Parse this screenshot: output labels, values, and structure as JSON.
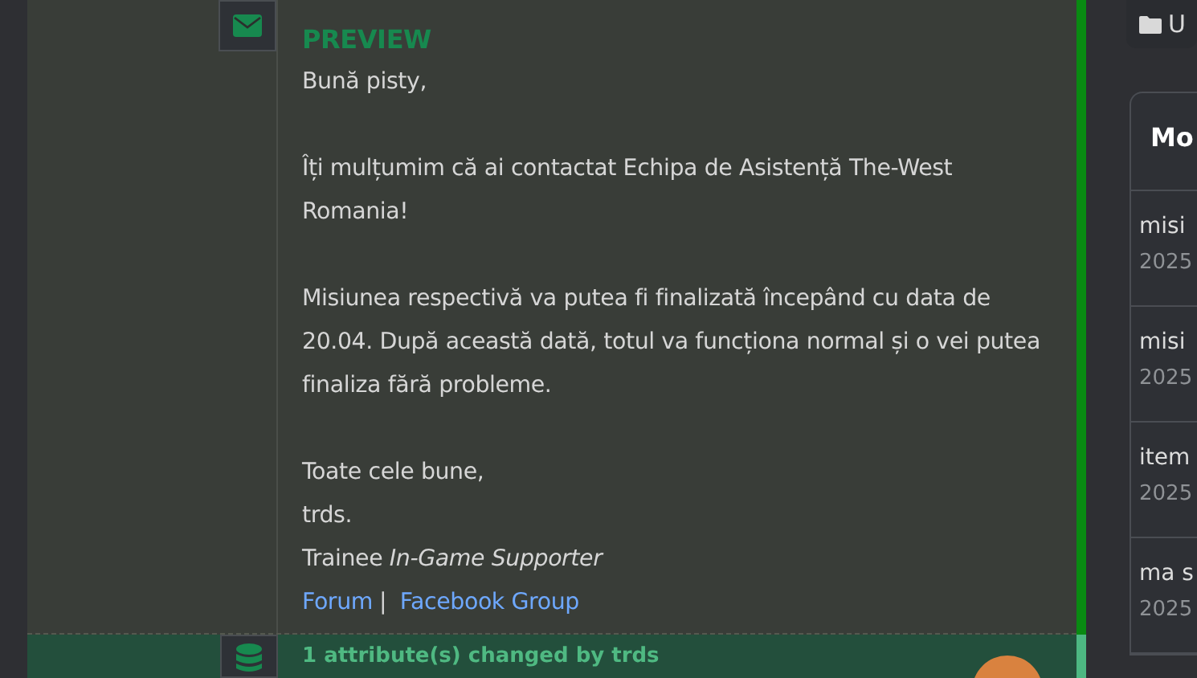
{
  "message": {
    "heading": "PREVIEW",
    "paragraphs": [
      "Bună pisty,",
      "Îți mulțumim că ai contactat Echipa de Asistență The-West Romania!",
      "Misiunea respectivă va putea fi finalizată începând cu data de 20.04. După această dată, totul va funcționa normal și o vei putea finaliza fără probleme."
    ],
    "signature": [
      "Toate cele bune,",
      "trds.",
      "Trainee *In-Game Supporter*"
    ],
    "links": [
      "Forum",
      "Facebook Group"
    ],
    "link_separator": "|"
  },
  "event": {
    "text": "1 attribute(s) changed by trds"
  },
  "sidebar": {
    "folder_label": "U",
    "panel_title": "Mo",
    "items": [
      {
        "title": "misi",
        "date": "2025"
      },
      {
        "title": "misi",
        "date": "2025"
      },
      {
        "title": "item",
        "date": "2025"
      },
      {
        "title": "ma s",
        "date": "2025"
      }
    ]
  }
}
